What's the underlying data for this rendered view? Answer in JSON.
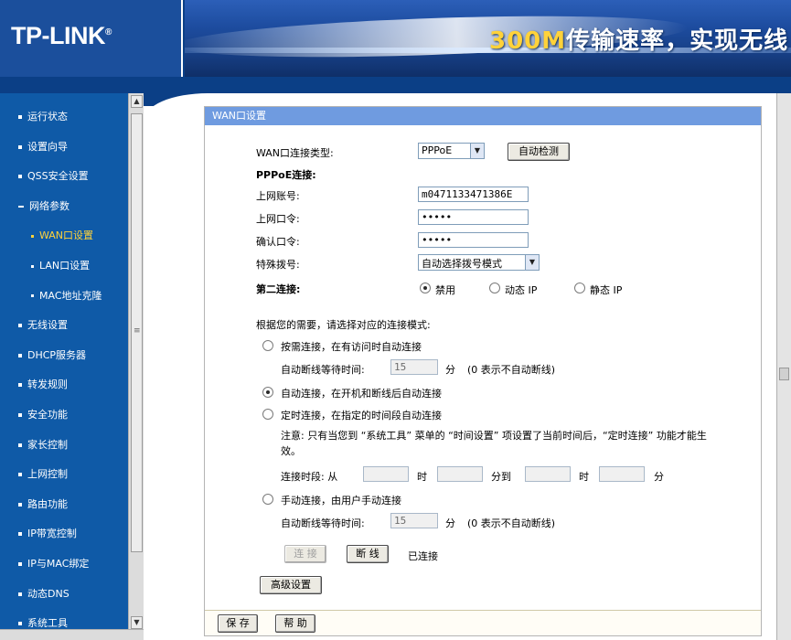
{
  "header": {
    "logo": "TP-LINK",
    "logo_mark": "®",
    "slogan_highlight": "300M",
    "slogan_rest": "传输速率，实现无线自由连接梦想"
  },
  "sidebar": {
    "items": [
      {
        "label": "运行状态",
        "sub": false,
        "active": false,
        "expanded": false
      },
      {
        "label": "设置向导",
        "sub": false,
        "active": false,
        "expanded": false
      },
      {
        "label": "QSS安全设置",
        "sub": false,
        "active": false,
        "expanded": false
      },
      {
        "label": "网络参数",
        "sub": false,
        "active": false,
        "expanded": true
      },
      {
        "label": "WAN口设置",
        "sub": true,
        "active": true,
        "expanded": false
      },
      {
        "label": "LAN口设置",
        "sub": true,
        "active": false,
        "expanded": false
      },
      {
        "label": "MAC地址克隆",
        "sub": true,
        "active": false,
        "expanded": false
      },
      {
        "label": "无线设置",
        "sub": false,
        "active": false,
        "expanded": false
      },
      {
        "label": "DHCP服务器",
        "sub": false,
        "active": false,
        "expanded": false
      },
      {
        "label": "转发规则",
        "sub": false,
        "active": false,
        "expanded": false
      },
      {
        "label": "安全功能",
        "sub": false,
        "active": false,
        "expanded": false
      },
      {
        "label": "家长控制",
        "sub": false,
        "active": false,
        "expanded": false
      },
      {
        "label": "上网控制",
        "sub": false,
        "active": false,
        "expanded": false
      },
      {
        "label": "路由功能",
        "sub": false,
        "active": false,
        "expanded": false
      },
      {
        "label": "IP带宽控制",
        "sub": false,
        "active": false,
        "expanded": false
      },
      {
        "label": "IP与MAC绑定",
        "sub": false,
        "active": false,
        "expanded": false
      },
      {
        "label": "动态DNS",
        "sub": false,
        "active": false,
        "expanded": false
      },
      {
        "label": "系统工具",
        "sub": false,
        "active": false,
        "expanded": false
      }
    ]
  },
  "panel": {
    "title": "WAN口设置",
    "wan_type_label": "WAN口连接类型:",
    "wan_type_value": "PPPoE",
    "auto_detect_button": "自动检测",
    "pppoe_heading": "PPPoE连接:",
    "account_label": "上网账号:",
    "account_value": "m0471133471386E",
    "password_label": "上网口令:",
    "password_value": "•••••",
    "confirm_label": "确认口令:",
    "confirm_value": "•••••",
    "dial_label": "特殊拨号:",
    "dial_value": "自动选择拨号模式",
    "second_conn_label": "第二连接:",
    "second_options": [
      "禁用",
      "动态 IP",
      "静态 IP"
    ],
    "second_selected": 0,
    "mode_prompt": "根据您的需要，请选择对应的连接模式:",
    "mode_on_demand": "按需连接，在有访问时自动连接",
    "idle_label": "自动断线等待时间:",
    "idle_value": "15",
    "idle_unit": "分",
    "idle_hint": "(0 表示不自动断线)",
    "mode_auto": "自动连接，在开机和断线后自动连接",
    "mode_timed": "定时连接，在指定的时间段自动连接",
    "timed_note": "注意: 只有当您到 “系统工具” 菜单的 “时间设置” 项设置了当前时间后，“定时连接” 功能才能生效。",
    "period_label": "连接时段: 从",
    "hour_unit": "时",
    "to_label": "分到",
    "min_unit": "分",
    "mode_manual": "手动连接，由用户手动连接",
    "idle_value2": "15",
    "mode_selected": 1,
    "connect_button": "连 接",
    "disconnect_button": "断 线",
    "status_text": "已连接",
    "advanced_button": "高级设置",
    "save_button": "保 存",
    "help_button": "帮 助"
  }
}
